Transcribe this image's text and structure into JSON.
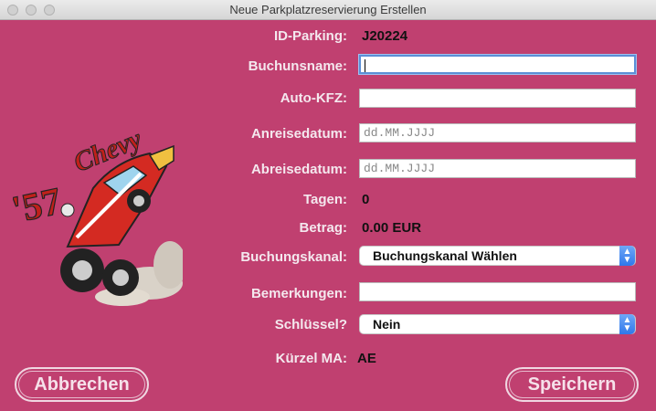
{
  "window": {
    "title": "Neue Parkplatzreservierung Erstellen"
  },
  "form": {
    "id_label": "ID-Parking:",
    "id_value": "J20224",
    "booking_name_label": "Buchunsname:",
    "booking_name_value": "",
    "car_plate_label": "Auto-KFZ:",
    "car_plate_value": "",
    "arrival_label": "Anreisedatum:",
    "arrival_placeholder": "dd.MM.JJJJ",
    "departure_label": "Abreisedatum:",
    "departure_placeholder": "dd.MM.JJJJ",
    "days_label": "Tagen:",
    "days_value": "0",
    "amount_label": "Betrag:",
    "amount_value": "0.00 EUR",
    "channel_label": "Buchungskanal:",
    "channel_selected": "Buchungskanal Wählen",
    "notes_label": "Bemerkungen:",
    "notes_value": "",
    "key_label": "Schlüssel?",
    "key_selected": "Nein",
    "employee_label": "Kürzel MA:",
    "employee_value": "AE"
  },
  "logo": {
    "text_1": "'57",
    "text_2": "Chevy"
  },
  "buttons": {
    "cancel": "Abbrechen",
    "save": "Speichern"
  },
  "colors": {
    "background": "#c04070",
    "select_accent": "#2f78ea"
  }
}
